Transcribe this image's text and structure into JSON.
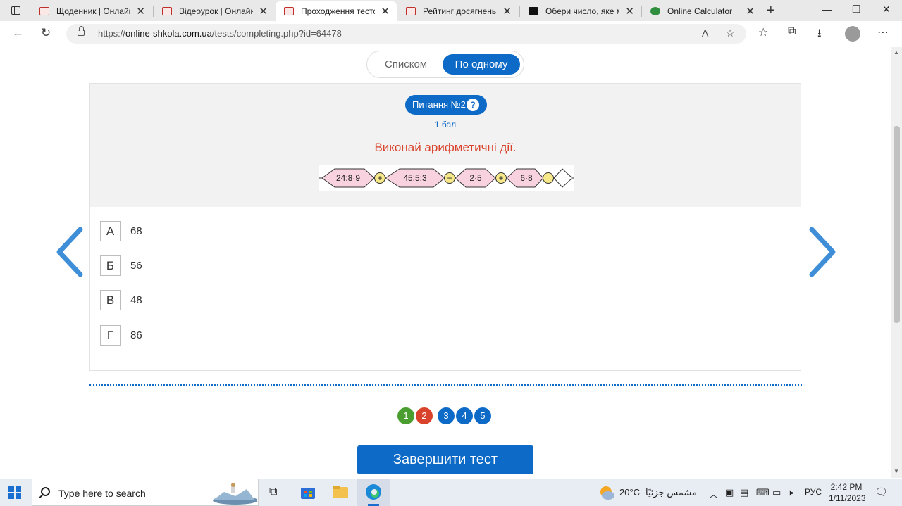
{
  "browser": {
    "tabs": [
      {
        "title": "Щоденник | Онлайн-ш"
      },
      {
        "title": "Відеоурок | Онлайн-ш"
      },
      {
        "title": "Проходження тестов"
      },
      {
        "title": "Рейтинг досягнень | О"
      },
      {
        "title": "Обери число, яке міс"
      },
      {
        "title": "Online Calculator"
      }
    ],
    "url_prefix": "https://",
    "url_domain": "online-shkola.com.ua",
    "url_path": "/tests/completing.php?id=64478"
  },
  "view_toggle": {
    "list_label": "Списком",
    "one_label": "По одному",
    "selected": "По одному"
  },
  "question": {
    "badge": "Питання №2",
    "help": "?",
    "points": "1 бал",
    "task": "Виконай арифметичні дії.",
    "chain": [
      "24:8·9",
      "+",
      "45:5:3",
      "−",
      "2·5",
      "+",
      "6·8",
      "="
    ]
  },
  "answers": [
    {
      "letter": "А",
      "text": "68"
    },
    {
      "letter": "Б",
      "text": "56"
    },
    {
      "letter": "В",
      "text": "48"
    },
    {
      "letter": "Г",
      "text": "86"
    }
  ],
  "pagination": [
    {
      "label": "1",
      "state": "answered",
      "color": "#4a9e2f"
    },
    {
      "label": "2",
      "state": "current",
      "color": "#d9432c"
    },
    {
      "label": "3",
      "state": "pending",
      "color": "#0d6ac6"
    },
    {
      "label": "4",
      "state": "pending",
      "color": "#0d6ac6"
    },
    {
      "label": "5",
      "state": "pending",
      "color": "#0d6ac6"
    }
  ],
  "finish_label": "Завершити тест",
  "taskbar": {
    "search_placeholder": "Type here to search",
    "weather": "20°C",
    "weather_desc": "مشمس جزئيًا",
    "lang": "РУС",
    "time": "2:42 PM",
    "date": "1/11/2023"
  },
  "colors": {
    "accent": "#0d6ac6",
    "task_text": "#d9432c",
    "chain_fill": "#f8d2de",
    "operator_fill": "#f7e98a"
  }
}
